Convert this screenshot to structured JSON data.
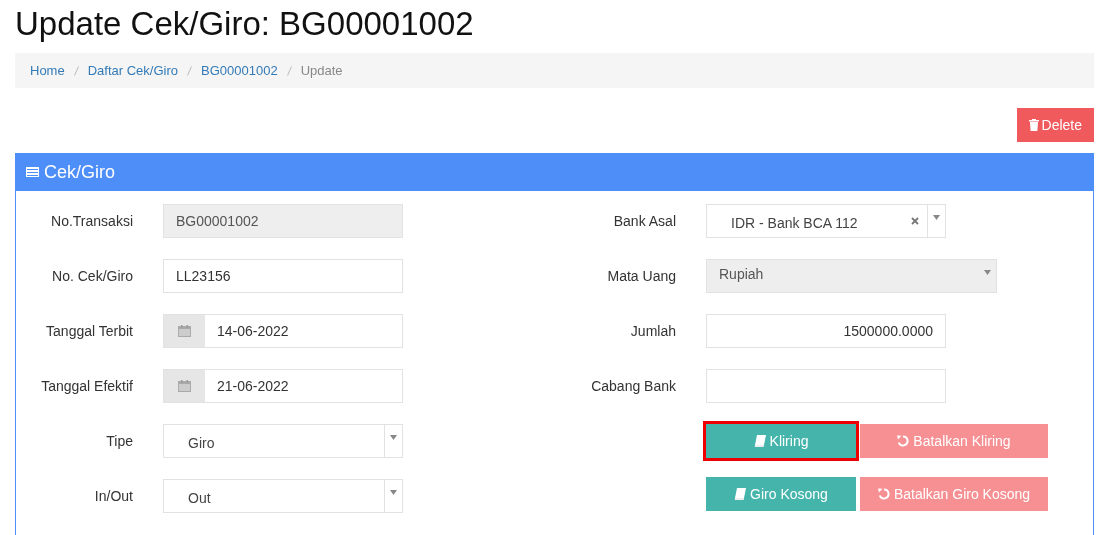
{
  "page_title": "Update Cek/Giro: BG00001002",
  "breadcrumb": [
    {
      "label": "Home",
      "current": false
    },
    {
      "label": "Daftar Cek/Giro",
      "current": false
    },
    {
      "label": "BG00001002",
      "current": false
    },
    {
      "label": "Update",
      "current": true
    }
  ],
  "delete_button": {
    "label": "Delete"
  },
  "panel": {
    "title": "Cek/Giro",
    "left_fields": [
      {
        "label": "No.Transaksi",
        "kind": "text",
        "value": "BG00001002",
        "disabled": true
      },
      {
        "label": "No. Cek/Giro",
        "kind": "text",
        "value": "LL23156",
        "disabled": false
      },
      {
        "label": "Tanggal Terbit",
        "kind": "date",
        "value": "14-06-2022",
        "disabled": false
      },
      {
        "label": "Tanggal Efektif",
        "kind": "date",
        "value": "21-06-2022",
        "disabled": false
      },
      {
        "label": "Tipe",
        "kind": "select",
        "value": "Giro",
        "disabled": false
      },
      {
        "label": "In/Out",
        "kind": "select",
        "value": "Out",
        "disabled": false
      }
    ],
    "right_fields": [
      {
        "label": "Bank Asal",
        "kind": "clear-select",
        "value": "IDR - Bank BCA 112",
        "disabled": false
      },
      {
        "label": "Mata Uang",
        "kind": "select",
        "value": "Rupiah",
        "disabled": true
      },
      {
        "label": "Jumlah",
        "kind": "number",
        "value": "1500000.0000",
        "disabled": false
      },
      {
        "label": "Cabang Bank",
        "kind": "text",
        "disabled": false
      }
    ],
    "actions": [
      {
        "label": "Kliring",
        "kind": "apply",
        "focused": true
      },
      {
        "label": "Batalkan Kliring",
        "kind": "undo",
        "focused": false
      },
      {
        "label": "Giro Kosong",
        "kind": "apply",
        "focused": false
      },
      {
        "label": "Batalkan Giro Kosong",
        "kind": "undo",
        "focused": false
      }
    ]
  }
}
